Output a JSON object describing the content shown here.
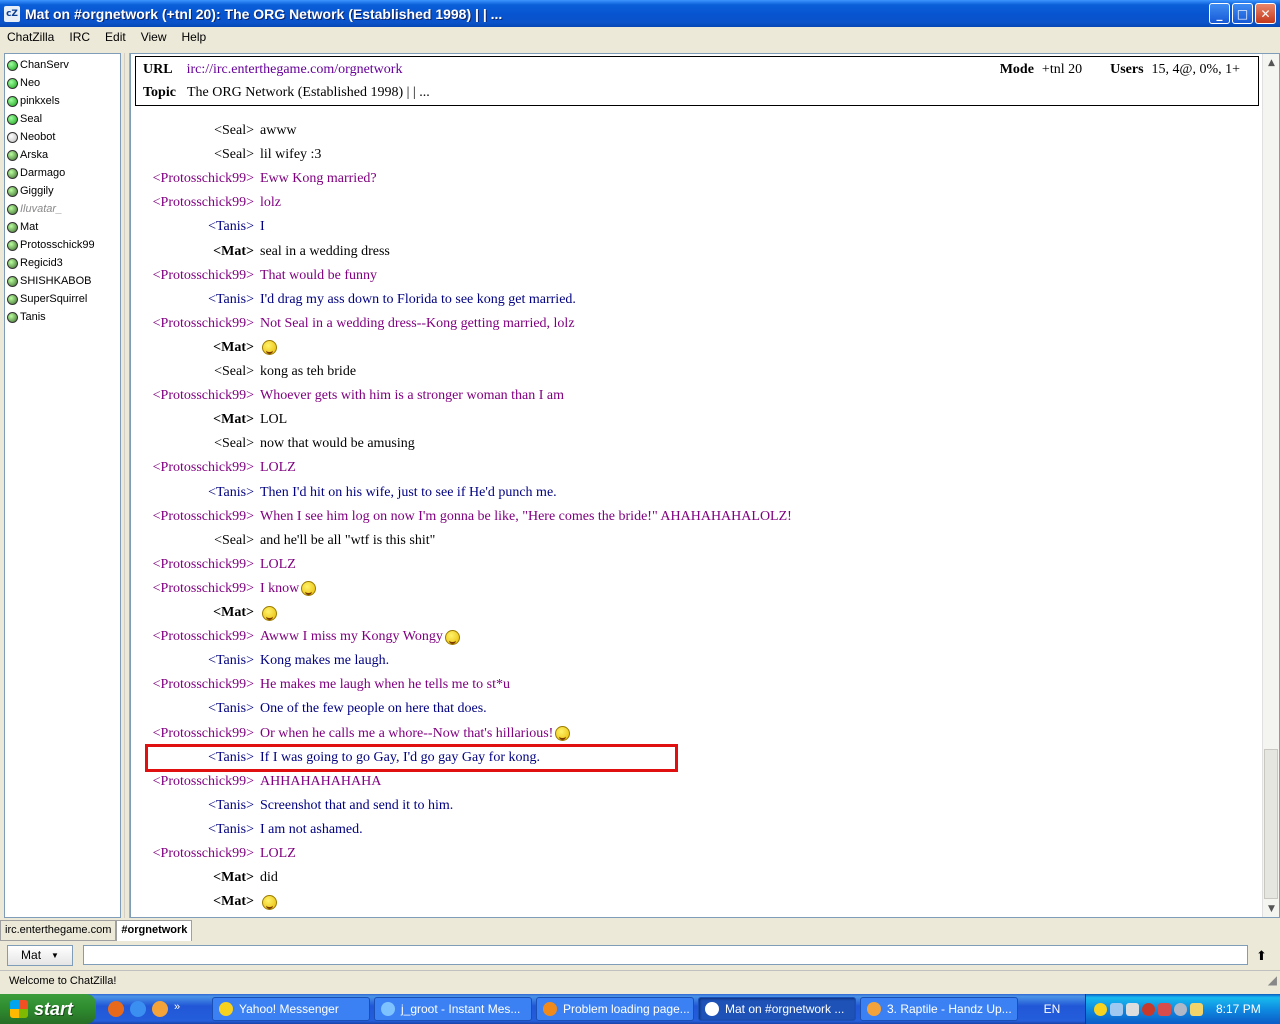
{
  "window": {
    "app_icon_text": "cZ",
    "title": "Mat on #orgnetwork (+tnl 20): The ORG Network (Established 1998) | | ...",
    "controls": [
      "_",
      "□",
      "✕"
    ]
  },
  "menu": [
    "ChatZilla",
    "IRC",
    "Edit",
    "View",
    "Help"
  ],
  "users": [
    {
      "nick": "ChanServ",
      "status": "op"
    },
    {
      "nick": "Neo",
      "status": "op"
    },
    {
      "nick": "pinkxels",
      "status": "op"
    },
    {
      "nick": "Seal",
      "status": "op"
    },
    {
      "nick": "Neobot",
      "status": "plain"
    },
    {
      "nick": "Arska",
      "status": "away"
    },
    {
      "nick": "Darmago",
      "status": "away"
    },
    {
      "nick": "Giggily",
      "status": "away"
    },
    {
      "nick": "Iluvatar_",
      "status": "away"
    },
    {
      "nick": "Mat",
      "status": "away"
    },
    {
      "nick": "Protosschick99",
      "status": "away"
    },
    {
      "nick": "Regicid3",
      "status": "away"
    },
    {
      "nick": "SHISHKABOB",
      "status": "away"
    },
    {
      "nick": "SuperSquirrel",
      "status": "away"
    },
    {
      "nick": "Tanis",
      "status": "away"
    }
  ],
  "header": {
    "url_label": "URL",
    "url": "irc://irc.enterthegame.com/orgnetwork",
    "topic_label": "Topic",
    "topic": "The ORG Network (Established 1998) | | ...",
    "mode_label": "Mode",
    "mode": "+tnl 20",
    "users_label": "Users",
    "users": "15, 4@, 0%, 1+"
  },
  "messages": [
    {
      "nick": "<Seal>",
      "text": "awww",
      "style": "plain",
      "smiley": false
    },
    {
      "nick": "<Seal>",
      "text": "lil wifey :3",
      "style": "plain",
      "smiley": false
    },
    {
      "nick": "<Protosschick99>",
      "text": "Eww Kong married?",
      "style": "purple",
      "smiley": false
    },
    {
      "nick": "<Protosschick99>",
      "text": "lolz",
      "style": "purple",
      "smiley": false
    },
    {
      "nick": "<Tanis>",
      "text": "I",
      "style": "navy",
      "smiley": false
    },
    {
      "nick": "<Mat>",
      "text": "seal in a wedding dress",
      "style": "me",
      "smiley": false
    },
    {
      "nick": "<Protosschick99>",
      "text": "That would be funny",
      "style": "purple",
      "smiley": false
    },
    {
      "nick": "<Tanis>",
      "text": "I'd drag my ass down to Florida to see kong get married.",
      "style": "navy",
      "smiley": false
    },
    {
      "nick": "<Protosschick99>",
      "text": "Not Seal in a wedding dress--Kong getting married, lolz",
      "style": "purple",
      "smiley": false
    },
    {
      "nick": "<Mat>",
      "text": "",
      "style": "me",
      "smiley": true
    },
    {
      "nick": "<Seal>",
      "text": "kong as teh bride",
      "style": "plain",
      "smiley": false
    },
    {
      "nick": "<Protosschick99>",
      "text": "Whoever gets with him is a stronger woman than I am",
      "style": "purple",
      "smiley": false
    },
    {
      "nick": "<Mat>",
      "text": "LOL",
      "style": "me",
      "smiley": false
    },
    {
      "nick": "<Seal>",
      "text": "now that would be amusing",
      "style": "plain",
      "smiley": false
    },
    {
      "nick": "<Protosschick99>",
      "text": "LOLZ",
      "style": "purple",
      "smiley": false
    },
    {
      "nick": "<Tanis>",
      "text": "Then I'd hit on his wife, just to see if He'd punch me.",
      "style": "navy",
      "smiley": false
    },
    {
      "nick": "<Protosschick99>",
      "text": "When I see him log on now I'm gonna be like, \"Here comes the bride!\" AHAHAHAHALOLZ!",
      "style": "purple",
      "smiley": false
    },
    {
      "nick": "<Seal>",
      "text": "and he'll be all \"wtf is this shit\"",
      "style": "plain",
      "smiley": false
    },
    {
      "nick": "<Protosschick99>",
      "text": "LOLZ",
      "style": "purple",
      "smiley": false
    },
    {
      "nick": "<Protosschick99>",
      "text": "I know",
      "style": "purple",
      "smiley": true
    },
    {
      "nick": "<Mat>",
      "text": "",
      "style": "me",
      "smiley": true
    },
    {
      "nick": "<Protosschick99>",
      "text": "Awww I miss my Kongy Wongy",
      "style": "purple",
      "smiley": true
    },
    {
      "nick": "<Tanis>",
      "text": "Kong makes me laugh.",
      "style": "navy",
      "smiley": false
    },
    {
      "nick": "<Protosschick99>",
      "text": "He makes me laugh when he tells me to st*u",
      "style": "purple",
      "smiley": false
    },
    {
      "nick": "<Tanis>",
      "text": "One of the few people on here that does.",
      "style": "navy",
      "smiley": false
    },
    {
      "nick": "<Protosschick99>",
      "text": "Or when he calls me a whore--Now that's hillarious!",
      "style": "purple",
      "smiley": true
    },
    {
      "nick": "<Tanis>",
      "text": "If I was going to go Gay, I'd go gay Gay for kong.",
      "style": "navy",
      "smiley": false
    },
    {
      "nick": "<Protosschick99>",
      "text": "AHHAHAHAHAHA",
      "style": "purple",
      "smiley": false
    },
    {
      "nick": "<Tanis>",
      "text": "Screenshot that and send it to him.",
      "style": "navy",
      "smiley": false
    },
    {
      "nick": "<Tanis>",
      "text": "I am not ashamed.",
      "style": "navy",
      "smiley": false
    },
    {
      "nick": "<Protosschick99>",
      "text": "LOLZ",
      "style": "purple",
      "smiley": false
    },
    {
      "nick": "<Mat>",
      "text": "did",
      "style": "me",
      "smiley": false
    },
    {
      "nick": "<Mat>",
      "text": "",
      "style": "me",
      "smiley": true
    }
  ],
  "tabs": [
    "irc.enterthegame.com",
    "#orgnetwork"
  ],
  "input": {
    "nick_button": "Mat",
    "value": ""
  },
  "status": "Welcome to ChatZilla!",
  "taskbar": {
    "start": "start",
    "tasks": [
      {
        "label": "Yahoo! Messenger",
        "color": "#f7d21e"
      },
      {
        "label": "j_groot - Instant Mes...",
        "color": "#7ec3ff"
      },
      {
        "label": "Problem loading page...",
        "color": "#f08a1c"
      },
      {
        "label": "Mat on #orgnetwork ...",
        "color": "#ffffff"
      },
      {
        "label": "3. Raptile - Handz Up...",
        "color": "#f3a33a"
      }
    ],
    "lang": "EN",
    "clock": "8:17 PM"
  },
  "colors": {
    "purple_text": "#800080",
    "navy_text": "#000080",
    "highlight_box": "#e01010"
  }
}
